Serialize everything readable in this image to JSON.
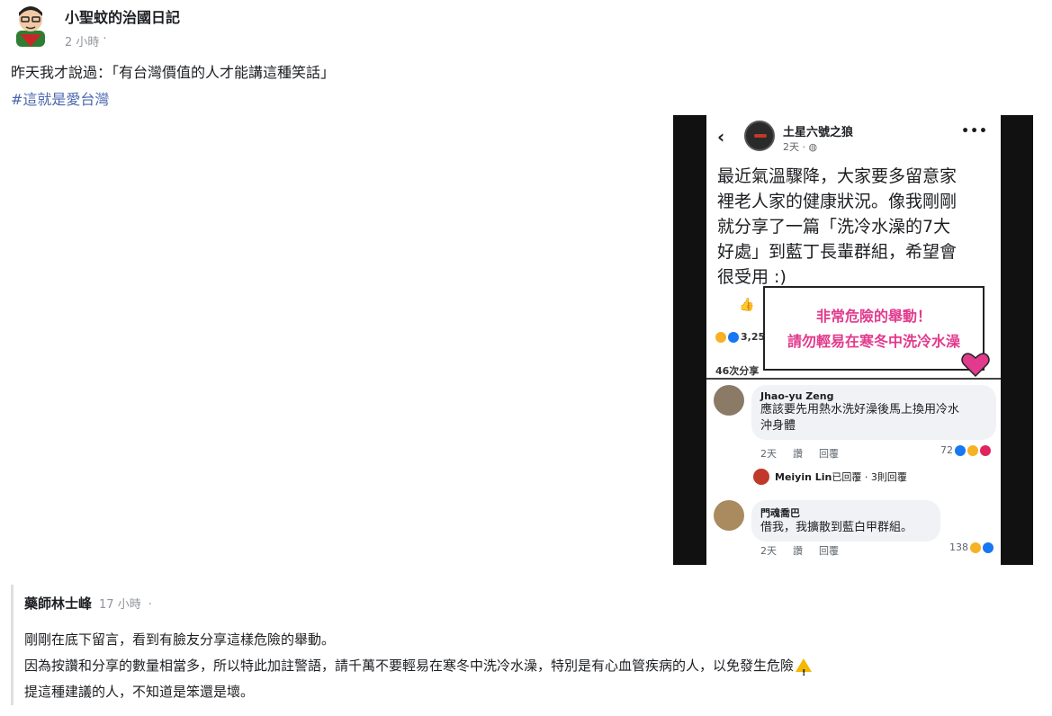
{
  "post": {
    "author": "小聖蚊的治國日記",
    "time": "2 小時",
    "privacy_dot": "·",
    "text_line1": "昨天我才說過：「有台灣價值的人才能講這種笑話」",
    "hashtag": "#這就是愛台灣"
  },
  "embed": {
    "header": {
      "back": "‹",
      "author": "土星六號之狼",
      "time": "2天 · ◍",
      "more": "•••"
    },
    "body_lines": [
      "最近氣溫驟降，大家要多留意家",
      "裡老人家的健康狀況。像我剛剛",
      "就分享了一篇「洗冷水澡的7大",
      "好處」到藍丁長輩群組，希望會",
      "很受用 :)"
    ],
    "like_icon": "👍",
    "reaction_count": "3,25",
    "shares": "46次分享",
    "warning": {
      "line1": "非常危險的舉動！",
      "line2": "請勿輕易在寒冬中洗冷水澡"
    },
    "comments": [
      {
        "name": "Jhao-yu Zeng",
        "text_line1": "應該要先用熱水洗好澡後馬上換用冷水",
        "text_line2": "沖身體",
        "time": "2天",
        "like": "讚",
        "reply": "回覆",
        "count": "72"
      },
      {
        "name": "門魂喬巴",
        "text_line1": "借我，我擴散到藍白甲群組。",
        "time": "2天",
        "like": "讚",
        "reply": "回覆",
        "count": "138"
      }
    ],
    "reply_summary": {
      "name": "Meiyin Lin",
      "text": "已回覆 · 3則回覆"
    }
  },
  "quote": {
    "author": "藥師林士峰",
    "time": "17 小時",
    "dot": "·",
    "line1": "剛剛在底下留言，看到有臉友分享這樣危險的舉動。",
    "line2": "因為按讚和分享的數量相當多，所以特此加註警語，請千萬不要輕易在寒冬中洗冷水澡，特別是有心血管疾病的人，以免發生危險",
    "line3": "提這種建議的人，不知道是笨還是壞。"
  },
  "colors": {
    "hashtag": "#4a67ad",
    "warning_pink": "#e23a8d",
    "meta_gray": "#90949c"
  }
}
